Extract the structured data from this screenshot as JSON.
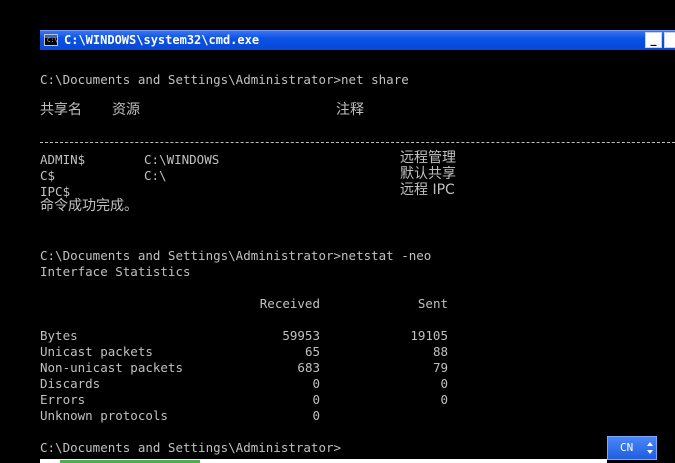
{
  "window": {
    "title": "C:\\WINDOWS\\system32\\cmd.exe",
    "minimize_glyph": "_"
  },
  "console": {
    "prompt1": "C:\\Documents and Settings\\Administrator>net share",
    "share_header": {
      "name": "共享名",
      "resource": "资源",
      "remark": "注释"
    },
    "shares": [
      {
        "name": "ADMIN$",
        "resource": "C:\\WINDOWS",
        "remark": "远程管理"
      },
      {
        "name": "C$",
        "resource": "C:\\",
        "remark": "默认共享"
      },
      {
        "name": "IPC$",
        "resource": "",
        "remark": "远程 IPC"
      }
    ],
    "success": "命令成功完成。",
    "prompt2": "C:\\Documents and Settings\\Administrator>netstat -neo",
    "stats_title": "Interface Statistics",
    "stats_headers": {
      "received": "Received",
      "sent": "Sent"
    },
    "stats": [
      {
        "label": "Bytes",
        "received": "59953",
        "sent": "19105"
      },
      {
        "label": "Unicast packets",
        "received": "65",
        "sent": "88"
      },
      {
        "label": "Non-unicast packets",
        "received": "683",
        "sent": "79"
      },
      {
        "label": "Discards",
        "received": "0",
        "sent": "0"
      },
      {
        "label": "Errors",
        "received": "0",
        "sent": "0"
      },
      {
        "label": "Unknown protocols",
        "received": "0",
        "sent": ""
      }
    ],
    "prompt3": "C:\\Documents and Settings\\Administrator>"
  },
  "ime": {
    "label": "CN"
  }
}
